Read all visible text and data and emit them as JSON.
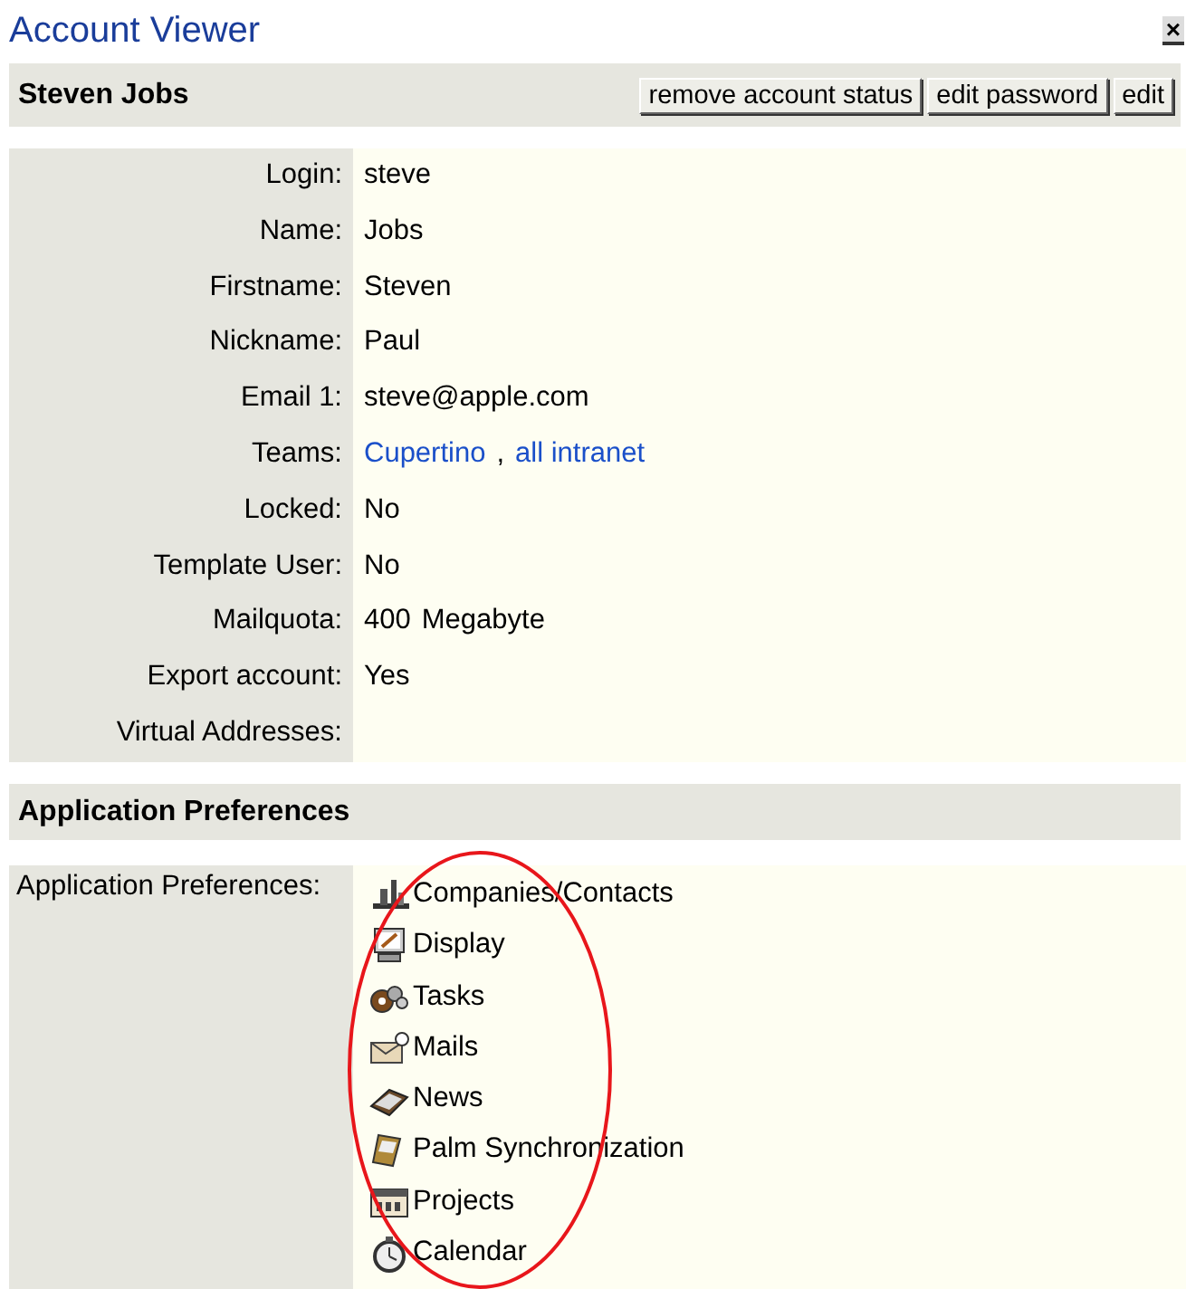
{
  "window": {
    "title": "Account Viewer",
    "close": "×"
  },
  "account": {
    "name": "Steven Jobs",
    "buttons": [
      "remove account status",
      "edit password",
      "edit"
    ]
  },
  "fields": [
    {
      "label": "Login:",
      "values": [
        {
          "kind": "text",
          "text": "steve"
        }
      ]
    },
    {
      "label": "Name:",
      "values": [
        {
          "kind": "text",
          "text": "Jobs"
        }
      ]
    },
    {
      "label": "Firstname:",
      "values": [
        {
          "kind": "text",
          "text": "Steven"
        }
      ]
    },
    {
      "label": "Nickname:",
      "values": [
        {
          "kind": "text",
          "text": "Paul"
        }
      ]
    },
    {
      "label": "Email 1:",
      "values": [
        {
          "kind": "text",
          "text": "steve@apple.com"
        }
      ]
    },
    {
      "label": "Teams:",
      "values": [
        {
          "kind": "link",
          "text": "Cupertino"
        },
        {
          "kind": "text",
          "text": ","
        },
        {
          "kind": "link",
          "text": "all intranet"
        }
      ]
    },
    {
      "label": "Locked:",
      "values": [
        {
          "kind": "text",
          "text": "No"
        }
      ]
    },
    {
      "label": "Template User:",
      "values": [
        {
          "kind": "text",
          "text": "No"
        }
      ]
    },
    {
      "label": "Mailquota:",
      "values": [
        {
          "kind": "text",
          "text": "400"
        },
        {
          "kind": "text",
          "text": "Megabyte"
        }
      ]
    },
    {
      "label": "Export account:",
      "values": [
        {
          "kind": "text",
          "text": "Yes"
        }
      ]
    },
    {
      "label": "Virtual Addresses:"
    }
  ],
  "preferences": {
    "title": "Application Preferences",
    "label": "Application Preferences:",
    "items": [
      "Companies/Contacts",
      "Display",
      "Tasks",
      "Mails",
      "News",
      "Palm Synchronization",
      "Projects",
      "Calendar"
    ]
  }
}
